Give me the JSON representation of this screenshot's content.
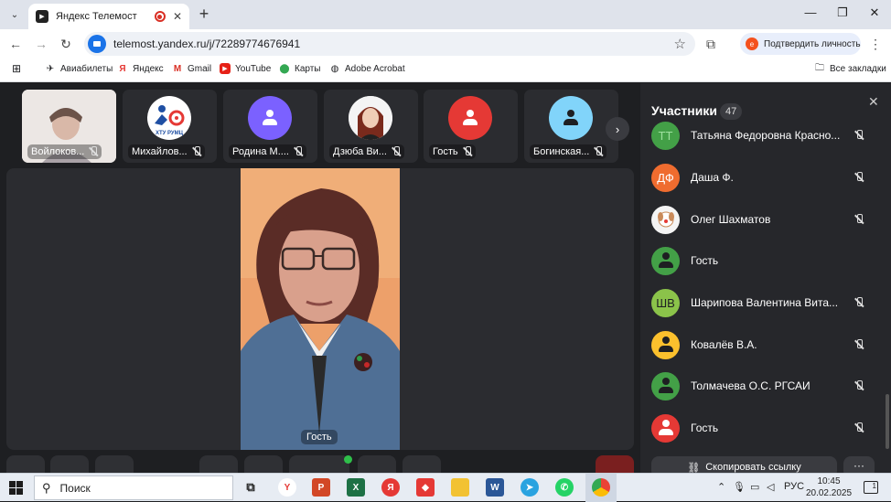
{
  "browser": {
    "tab_title": "Яндекс Телемост",
    "url": "telemost.yandex.ru/j/72289774676941",
    "verify_label": "Подтвердить личность",
    "bookmarks": [
      "Авиабилеты",
      "Яндекс",
      "Gmail",
      "YouTube",
      "Карты",
      "Adobe Acrobat"
    ],
    "all_bookmarks": "Все закладки"
  },
  "strip": {
    "tiles": [
      {
        "name": "Войлоков..."
      },
      {
        "name": "Михайлов...",
        "logo_text": "ХТУ РУМЦ"
      },
      {
        "name": "Родина М...."
      },
      {
        "name": "Дзюба Ви..."
      },
      {
        "name": "Гость"
      },
      {
        "name": "Богинская..."
      }
    ]
  },
  "stage": {
    "speaker_name": "Гость"
  },
  "participants": {
    "title": "Участники",
    "count": "47",
    "items": [
      {
        "initials": "ТТ",
        "name": "Татьяна Федоровна Красно..."
      },
      {
        "initials": "ДФ",
        "name": "Даша Ф."
      },
      {
        "initials": "",
        "name": "Олег Шахматов"
      },
      {
        "initials": "",
        "name": "Гость"
      },
      {
        "initials": "ШВ",
        "name": "Шарипова Валентина Вита..."
      },
      {
        "initials": "",
        "name": "Ковалёв В.А."
      },
      {
        "initials": "",
        "name": "Толмачева О.С. РГСАИ"
      },
      {
        "initials": "",
        "name": "Гость"
      }
    ],
    "copy_link_label": "Скопировать ссылку"
  },
  "taskbar": {
    "search_placeholder": "Поиск",
    "lang": "РУС",
    "time": "10:45",
    "date": "20.02.2025",
    "notifications": "1"
  },
  "colors": {
    "accent_green": "#43a047",
    "avatar_purple": "#7b61ff",
    "avatar_red": "#e53935",
    "avatar_cyan": "#81d4fa",
    "avatar_orange": "#ef6c2f",
    "avatar_yellow": "#fbc02d",
    "avatar_lime": "#8bc34a"
  }
}
